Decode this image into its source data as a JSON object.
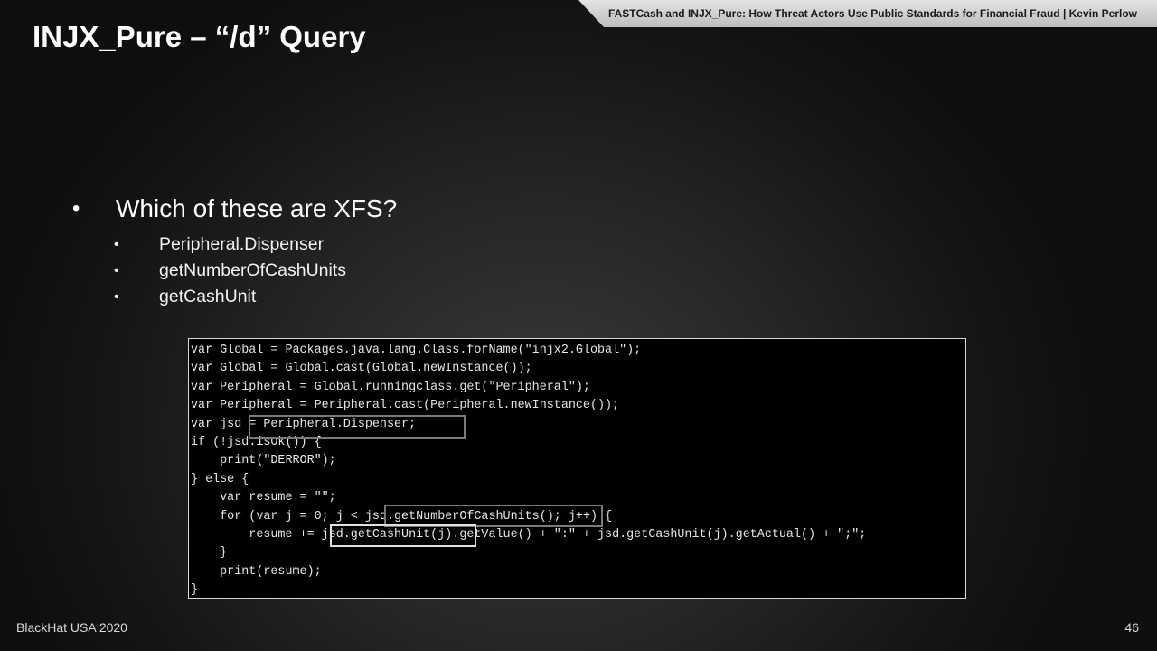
{
  "header": {
    "text": "FASTCash and INJX_Pure: How Threat Actors Use Public Standards for Financial Fraud | Kevin Perlow"
  },
  "title": "INJX_Pure – “/d” Query",
  "bullet": {
    "text": "Which of these are XFS?",
    "sub": [
      "Peripheral.Dispenser",
      "getNumberOfCashUnits",
      "getCashUnit"
    ]
  },
  "code": [
    "var Global = Packages.java.lang.Class.forName(\"injx2.Global\");",
    "var Global = Global.cast(Global.newInstance());",
    "var Peripheral = Global.runningclass.get(\"Peripheral\");",
    "var Peripheral = Peripheral.cast(Peripheral.newInstance());",
    "var jsd = Peripheral.Dispenser;",
    "if (!jsd.isOk()) {",
    "    print(\"DERROR\");",
    "} else {",
    "    var resume = \"\";",
    "    for (var j = 0; j < jsd.getNumberOfCashUnits(); j++) {",
    "        resume += jsd.getCashUnit(j).getValue() + \":\" + jsd.getCashUnit(j).getActual() + \";\";",
    "    }",
    "    print(resume);",
    "}"
  ],
  "footer": {
    "left": "BlackHat USA 2020",
    "page_number": "46"
  }
}
